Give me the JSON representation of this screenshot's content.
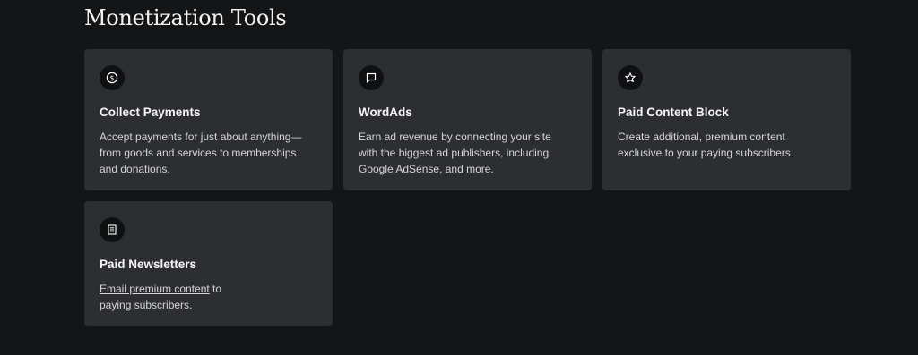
{
  "section": {
    "title": "Monetization Tools"
  },
  "cards": [
    {
      "icon": "dollar-circle-icon",
      "title": "Collect Payments",
      "desc_lines": [
        "Accept payments for just about anything—",
        "from goods and services to memberships",
        "and donations."
      ]
    },
    {
      "icon": "speech-bubble-icon",
      "title": "WordAds",
      "desc_lines": [
        "Earn ad revenue by connecting your site",
        "with the biggest ad publishers, including",
        "Google AdSense, and more."
      ]
    },
    {
      "icon": "star-icon",
      "title": "Paid Content Block",
      "desc_lines": [
        "Create additional, premium content",
        "exclusive to your paying subscribers."
      ]
    },
    {
      "icon": "newsletter-icon",
      "title": "Paid Newsletters",
      "desc_link": "Email premium content",
      "desc_after_link": " to",
      "desc_line2": "paying subscribers."
    }
  ]
}
